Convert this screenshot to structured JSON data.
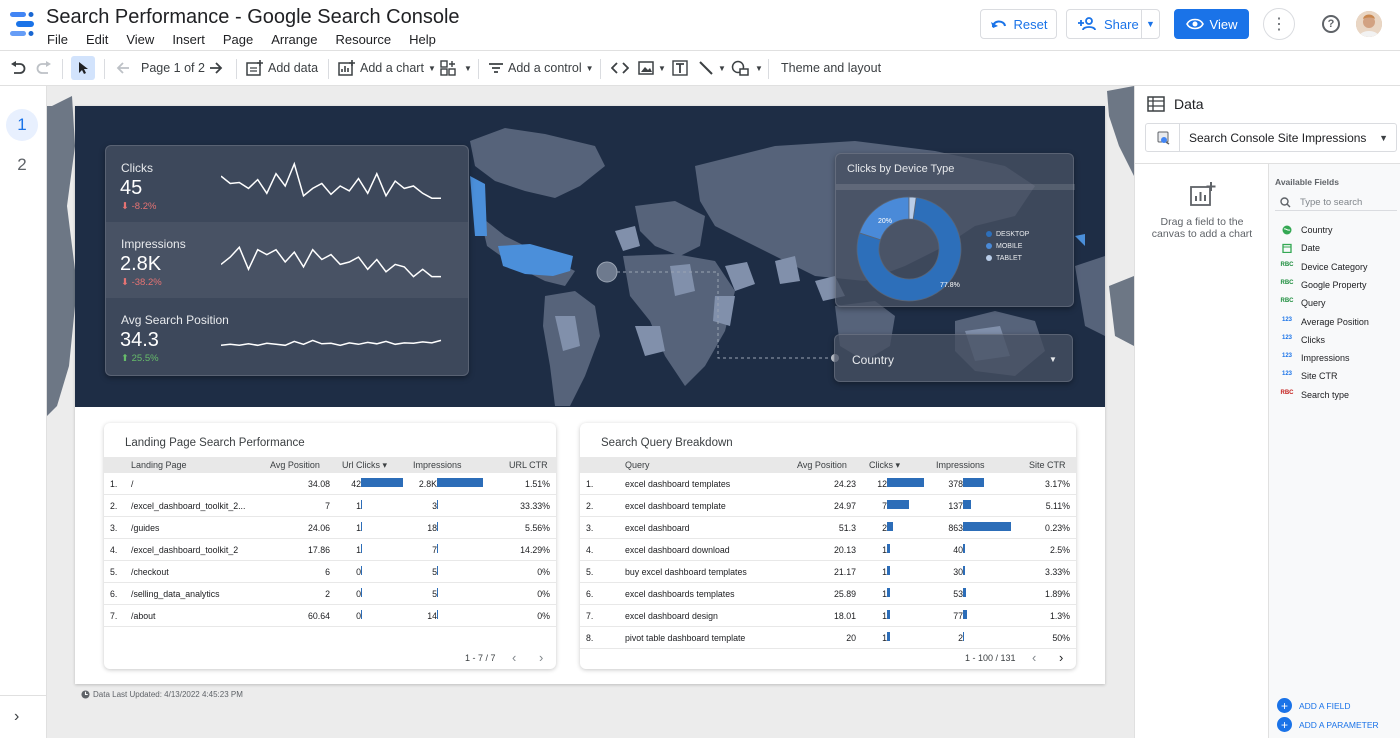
{
  "app": {
    "title": "Search Performance - Google Search Console",
    "menu": [
      "File",
      "Edit",
      "View",
      "Insert",
      "Page",
      "Arrange",
      "Resource",
      "Help"
    ],
    "reset": "Reset",
    "share": "Share",
    "view": "View",
    "more": "⋮",
    "help": "?"
  },
  "toolbar": {
    "page_indicator": "Page 1 of 2",
    "add_data": "Add data",
    "add_chart": "Add a chart",
    "add_control": "Add a control",
    "theme_layout": "Theme and layout"
  },
  "pages": [
    "1",
    "2"
  ],
  "kpis": [
    {
      "label": "Clicks",
      "value": "45",
      "change": "-8.2%",
      "direction": "down",
      "spark": [
        0.35,
        0.5,
        0.48,
        0.6,
        0.42,
        0.7,
        0.3,
        0.55,
        0.1,
        0.75,
        0.6,
        0.5,
        0.72,
        0.55,
        0.65,
        0.4,
        0.7,
        0.3,
        0.75,
        0.45,
        0.6,
        0.55,
        0.7,
        0.8,
        0.8
      ]
    },
    {
      "label": "Impressions",
      "value": "2.8K",
      "change": "-38.2%",
      "direction": "down",
      "spark": [
        0.6,
        0.45,
        0.25,
        0.7,
        0.3,
        0.4,
        0.3,
        0.55,
        0.35,
        0.65,
        0.3,
        0.5,
        0.4,
        0.6,
        0.55,
        0.45,
        0.7,
        0.5,
        0.75,
        0.6,
        0.65,
        0.85,
        0.7,
        0.85,
        0.85
      ]
    },
    {
      "label": "Avg Search Position",
      "value": "34.3",
      "change": "25.5%",
      "direction": "up",
      "spark": [
        0.7,
        0.68,
        0.7,
        0.67,
        0.7,
        0.66,
        0.68,
        0.7,
        0.62,
        0.68,
        0.6,
        0.67,
        0.66,
        0.7,
        0.65,
        0.68,
        0.64,
        0.67,
        0.62,
        0.68,
        0.65,
        0.66,
        0.63,
        0.65,
        0.6
      ]
    }
  ],
  "device_chart": {
    "title": "Clicks by Device Type",
    "legend": [
      "DESKTOP",
      "MOBILE",
      "TABLET"
    ],
    "desktop_label": "77.8%",
    "mobile_label": "20%",
    "colors": {
      "desktop": "#2d6fba",
      "mobile": "#4a8ad8",
      "tablet": "#b9cde8"
    }
  },
  "chart_data": [
    {
      "type": "line",
      "title": "Clicks",
      "series": [
        {
          "name": "Clicks",
          "values": [
            0.35,
            0.5,
            0.48,
            0.6,
            0.42,
            0.7,
            0.3,
            0.55,
            0.1,
            0.75,
            0.6,
            0.5,
            0.72,
            0.55,
            0.65,
            0.4,
            0.7,
            0.3,
            0.75,
            0.45,
            0.6,
            0.55,
            0.7,
            0.8,
            0.8
          ]
        }
      ]
    },
    {
      "type": "pie",
      "title": "Clicks by Device Type",
      "categories": [
        "DESKTOP",
        "MOBILE",
        "TABLET"
      ],
      "values": [
        77.8,
        20,
        2.2
      ]
    }
  ],
  "country_control": {
    "label": "Country"
  },
  "landing_table": {
    "title": "Landing Page Search Performance",
    "headers": [
      "Landing Page",
      "Avg Position",
      "Url Clicks ▾",
      "Impressions",
      "URL CTR"
    ],
    "rows": [
      {
        "n": "1.",
        "page": "/",
        "pos": "34.08",
        "clicks": "42",
        "clicks_v": 42,
        "impr": "2.8K",
        "impr_v": 2800,
        "ctr": "1.51%"
      },
      {
        "n": "2.",
        "page": "/excel_dashboard_toolkit_2...",
        "pos": "7",
        "clicks": "1",
        "clicks_v": 1,
        "impr": "3",
        "impr_v": 3,
        "ctr": "33.33%"
      },
      {
        "n": "3.",
        "page": "/guides",
        "pos": "24.06",
        "clicks": "1",
        "clicks_v": 1,
        "impr": "18",
        "impr_v": 18,
        "ctr": "5.56%"
      },
      {
        "n": "4.",
        "page": "/excel_dashboard_toolkit_2",
        "pos": "17.86",
        "clicks": "1",
        "clicks_v": 1,
        "impr": "7",
        "impr_v": 7,
        "ctr": "14.29%"
      },
      {
        "n": "5.",
        "page": "/checkout",
        "pos": "6",
        "clicks": "0",
        "clicks_v": 0,
        "impr": "5",
        "impr_v": 5,
        "ctr": "0%"
      },
      {
        "n": "6.",
        "page": "/selling_data_analytics",
        "pos": "2",
        "clicks": "0",
        "clicks_v": 0,
        "impr": "5",
        "impr_v": 5,
        "ctr": "0%"
      },
      {
        "n": "7.",
        "page": "/about",
        "pos": "60.64",
        "clicks": "0",
        "clicks_v": 0,
        "impr": "14",
        "impr_v": 14,
        "ctr": "0%"
      }
    ],
    "pager": "1 - 7 / 7"
  },
  "query_table": {
    "title": "Search Query Breakdown",
    "headers": [
      "Query",
      "Avg Position",
      "Clicks ▾",
      "Impressions",
      "Site CTR"
    ],
    "rows": [
      {
        "n": "1.",
        "query": "excel dashboard templates",
        "pos": "24.23",
        "clicks": "12",
        "clicks_v": 12,
        "impr": "378",
        "impr_v": 378,
        "ctr": "3.17%"
      },
      {
        "n": "2.",
        "query": "excel dashboard template",
        "pos": "24.97",
        "clicks": "7",
        "clicks_v": 7,
        "impr": "137",
        "impr_v": 137,
        "ctr": "5.11%"
      },
      {
        "n": "3.",
        "query": "excel dashboard",
        "pos": "51.3",
        "clicks": "2",
        "clicks_v": 2,
        "impr": "863",
        "impr_v": 863,
        "ctr": "0.23%"
      },
      {
        "n": "4.",
        "query": "excel dashboard download",
        "pos": "20.13",
        "clicks": "1",
        "clicks_v": 1,
        "impr": "40",
        "impr_v": 40,
        "ctr": "2.5%"
      },
      {
        "n": "5.",
        "query": "buy excel dashboard templates",
        "pos": "21.17",
        "clicks": "1",
        "clicks_v": 1,
        "impr": "30",
        "impr_v": 30,
        "ctr": "3.33%"
      },
      {
        "n": "6.",
        "query": "excel dashboards templates",
        "pos": "25.89",
        "clicks": "1",
        "clicks_v": 1,
        "impr": "53",
        "impr_v": 53,
        "ctr": "1.89%"
      },
      {
        "n": "7.",
        "query": "excel dashboard design",
        "pos": "18.01",
        "clicks": "1",
        "clicks_v": 1,
        "impr": "77",
        "impr_v": 77,
        "ctr": "1.3%"
      },
      {
        "n": "8.",
        "query": "pivot table dashboard template",
        "pos": "20",
        "clicks": "1",
        "clicks_v": 1,
        "impr": "2",
        "impr_v": 2,
        "ctr": "50%"
      }
    ],
    "pager": "1 - 100 / 131"
  },
  "data_updated": "Data Last Updated: 4/13/2022 4:45:23 PM",
  "data_panel": {
    "title": "Data",
    "source": "Search Console Site Impressions",
    "drag_text": "Drag a field to the canvas to add a chart",
    "available_title": "Available Fields",
    "search_placeholder": "Type to search",
    "fields": [
      {
        "type": "geo",
        "name": "Country"
      },
      {
        "type": "date",
        "name": "Date"
      },
      {
        "type": "RBC",
        "name": "Device Category"
      },
      {
        "type": "RBC",
        "name": "Google Property"
      },
      {
        "type": "RBC",
        "name": "Query"
      },
      {
        "type": "123",
        "name": "Average Position"
      },
      {
        "type": "123",
        "name": "Clicks"
      },
      {
        "type": "123",
        "name": "Impressions"
      },
      {
        "type": "123",
        "name": "Site CTR"
      },
      {
        "type": "RBC",
        "name": "Search type"
      }
    ],
    "add_field": "ADD A FIELD",
    "add_parameter": "ADD A PARAMETER"
  }
}
